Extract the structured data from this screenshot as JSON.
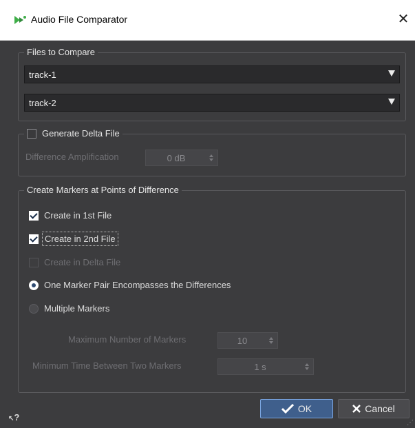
{
  "window": {
    "title": "Audio File Comparator",
    "close_glyph": "✕"
  },
  "files_group": {
    "legend": "Files to Compare",
    "file1": "track-1",
    "file2": "track-2"
  },
  "delta_group": {
    "legend": "Generate Delta File",
    "generate_checked": false,
    "amplification_label": "Difference Amplification",
    "amplification_value": "0 dB"
  },
  "markers_group": {
    "legend": "Create Markers at Points of Difference",
    "create_first": {
      "label": "Create in 1st File",
      "checked": true
    },
    "create_second": {
      "label": "Create in 2nd File",
      "checked": true
    },
    "create_delta": {
      "label": "Create in Delta File",
      "checked": false,
      "enabled": false
    },
    "mode_pair": {
      "label": "One Marker Pair Encompasses the Differences",
      "selected": true
    },
    "mode_multiple": {
      "label": "Multiple Markers",
      "selected": false
    },
    "max_markers_label": "Maximum Number of Markers",
    "max_markers_value": "10",
    "min_time_label": "Minimum Time Between Two Markers",
    "min_time_value": "1 s"
  },
  "buttons": {
    "ok": "OK",
    "cancel": "Cancel"
  },
  "help_glyph": "?",
  "colors": {
    "background": "#3c3c3e",
    "accent": "#3f5f8c",
    "accent_border": "#7ba6e0"
  }
}
